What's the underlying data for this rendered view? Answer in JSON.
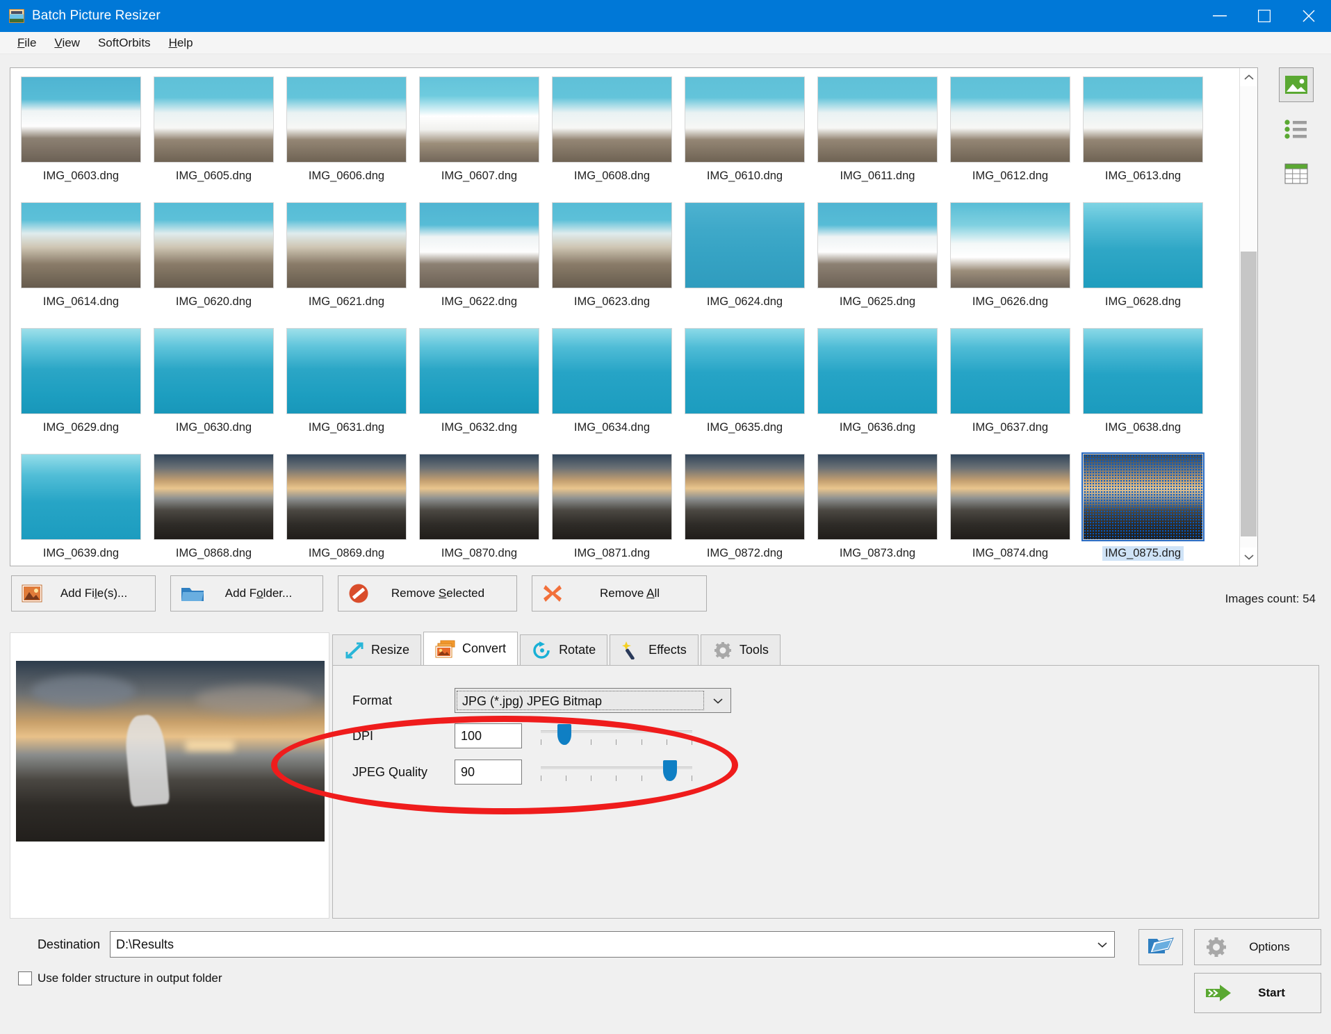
{
  "window": {
    "title": "Batch Picture Resizer",
    "icon": "app-icon",
    "minimize": "minimize-icon",
    "maximize": "maximize-icon",
    "close": "close-icon"
  },
  "menubar": {
    "items": [
      {
        "label": "File",
        "accel": "F"
      },
      {
        "label": "View",
        "accel": "V"
      },
      {
        "label": "SoftOrbits",
        "accel": ""
      },
      {
        "label": "Help",
        "accel": "H"
      }
    ]
  },
  "view_modes": [
    {
      "name": "thumbnail-view",
      "active": true
    },
    {
      "name": "list-view",
      "active": false
    },
    {
      "name": "table-view",
      "active": false
    }
  ],
  "thumbnails": {
    "selected": "IMG_0875.dng",
    "items": [
      {
        "label": "IMG_0603.dng",
        "scene": "wave-foam"
      },
      {
        "label": "IMG_0605.dng",
        "scene": "girl-in-surf"
      },
      {
        "label": "IMG_0606.dng",
        "scene": "girl-in-surf"
      },
      {
        "label": "IMG_0607.dng",
        "scene": "wave-crest"
      },
      {
        "label": "IMG_0608.dng",
        "scene": "girl-in-surf"
      },
      {
        "label": "IMG_0610.dng",
        "scene": "girl-in-surf"
      },
      {
        "label": "IMG_0611.dng",
        "scene": "girl-in-surf"
      },
      {
        "label": "IMG_0612.dng",
        "scene": "girl-in-surf"
      },
      {
        "label": "IMG_0613.dng",
        "scene": "girl-in-surf"
      },
      {
        "label": "IMG_0614.dng",
        "scene": "girl-on-shore"
      },
      {
        "label": "IMG_0620.dng",
        "scene": "girl-on-shore"
      },
      {
        "label": "IMG_0621.dng",
        "scene": "girl-on-shore"
      },
      {
        "label": "IMG_0622.dng",
        "scene": "wave-foam"
      },
      {
        "label": "IMG_0623.dng",
        "scene": "girl-on-shore"
      },
      {
        "label": "IMG_0624.dng",
        "scene": "girl-floating"
      },
      {
        "label": "IMG_0625.dng",
        "scene": "wave-foam"
      },
      {
        "label": "IMG_0626.dng",
        "scene": "girl-splash"
      },
      {
        "label": "IMG_0628.dng",
        "scene": "open-sea-swimmer"
      },
      {
        "label": "IMG_0629.dng",
        "scene": "open-sea"
      },
      {
        "label": "IMG_0630.dng",
        "scene": "open-sea"
      },
      {
        "label": "IMG_0631.dng",
        "scene": "open-sea"
      },
      {
        "label": "IMG_0632.dng",
        "scene": "open-sea"
      },
      {
        "label": "IMG_0634.dng",
        "scene": "paddleboarder"
      },
      {
        "label": "IMG_0635.dng",
        "scene": "paddleboarder"
      },
      {
        "label": "IMG_0636.dng",
        "scene": "paddleboarder"
      },
      {
        "label": "IMG_0637.dng",
        "scene": "paddleboarder"
      },
      {
        "label": "IMG_0638.dng",
        "scene": "swimmer-vest"
      },
      {
        "label": "IMG_0639.dng",
        "scene": "sea-pier"
      },
      {
        "label": "IMG_0868.dng",
        "scene": "sunset-beach-figure"
      },
      {
        "label": "IMG_0869.dng",
        "scene": "sunset-beach-figure"
      },
      {
        "label": "IMG_0870.dng",
        "scene": "sunset-beach-figure"
      },
      {
        "label": "IMG_0871.dng",
        "scene": "sunset-beach-figure"
      },
      {
        "label": "IMG_0872.dng",
        "scene": "sunset-beach-figure"
      },
      {
        "label": "IMG_0873.dng",
        "scene": "sunset-beach-figure"
      },
      {
        "label": "IMG_0874.dng",
        "scene": "sunset-beach-figure"
      },
      {
        "label": "IMG_0875.dng",
        "scene": "sunset-beach-figure"
      }
    ]
  },
  "toolbar": {
    "add_files": "Add File(s)...",
    "add_files_accel": "l",
    "add_folder": "Add Folder...",
    "add_folder_accel": "o",
    "remove_selected": "Remove Selected",
    "remove_selected_accel": "S",
    "remove_all": "Remove All",
    "remove_all_accel": "A",
    "images_count": "Images count: 54"
  },
  "tabs": [
    {
      "label": "Resize",
      "icon": "resize-arrows-icon",
      "active": false
    },
    {
      "label": "Convert",
      "icon": "convert-images-icon",
      "active": true
    },
    {
      "label": "Rotate",
      "icon": "rotate-arrow-icon",
      "active": false
    },
    {
      "label": "Effects",
      "icon": "magic-wand-icon",
      "active": false
    },
    {
      "label": "Tools",
      "icon": "gear-icon",
      "active": false
    }
  ],
  "convert": {
    "format_label": "Format",
    "format_value": "JPG (*.jpg) JPEG Bitmap",
    "dpi_label": "DPI",
    "dpi_value": "100",
    "dpi_slider_percent": 12,
    "quality_label": "JPEG Quality",
    "quality_value": "90",
    "quality_slider_percent": 89
  },
  "destination": {
    "label": "Destination",
    "value": "D:\\Results",
    "browse_icon": "open-folder-icon",
    "use_folder_structure": "Use folder structure in output folder",
    "use_folder_structure_checked": false
  },
  "bottom_buttons": {
    "options": "Options",
    "options_icon": "gear-icon",
    "start": "Start",
    "start_icon": "green-arrow-icon"
  },
  "colors": {
    "titlebar": "#0078d7",
    "accent_blue": "#0f7fc4",
    "annotation_red": "#ef1c1c",
    "start_green": "#5aa832"
  }
}
